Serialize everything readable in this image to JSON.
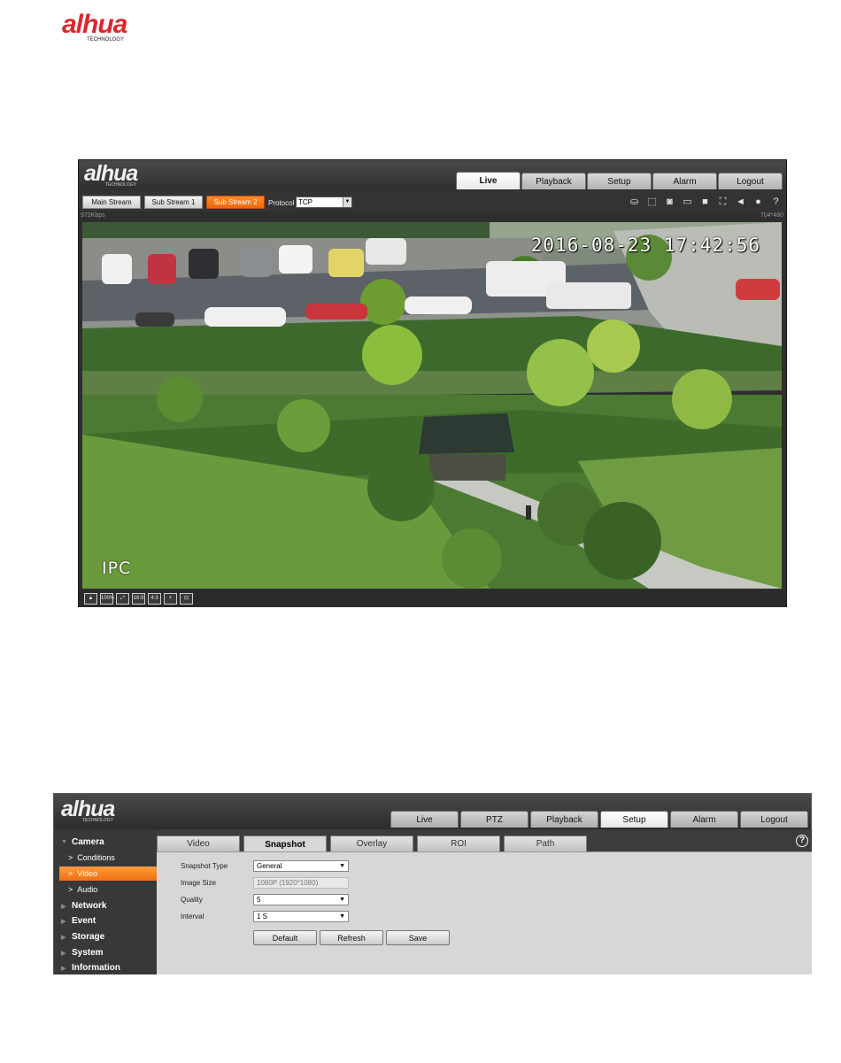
{
  "page": {
    "logo_text": "alhua",
    "logo_sub": "TECHNOLOGY"
  },
  "live": {
    "logo_text": "alhua",
    "logo_sub": "TECHNOLOGY",
    "tabs": [
      {
        "label": "Live",
        "active": true
      },
      {
        "label": "Playback",
        "active": false
      },
      {
        "label": "Setup",
        "active": false
      },
      {
        "label": "Alarm",
        "active": false
      },
      {
        "label": "Logout",
        "active": false
      }
    ],
    "streams": {
      "main": "Main Stream",
      "sub1": "Sub Stream 1",
      "sub2": "Sub Stream 2",
      "active": "Sub Stream 2"
    },
    "protocol_label": "Protocol",
    "protocol_value": "TCP",
    "bitrate": "972Kbps",
    "resolution": "704*480",
    "osd_time": "2016-08-23 17:42:56",
    "osd_name": "IPC",
    "toolbar_icons": [
      "user-icon",
      "region-zoom-icon",
      "snapshot-icon",
      "triple-snapshot-icon",
      "record-icon",
      "fullscreen-icon",
      "volume-icon",
      "microphone-icon",
      "help-icon"
    ],
    "bottom_icons": [
      {
        "name": "image-adjust-icon",
        "glyph": "▲"
      },
      {
        "name": "original-size-icon",
        "glyph": "100%"
      },
      {
        "name": "fit-window-icon",
        "glyph": "⤢"
      },
      {
        "name": "ratio-16-9-icon",
        "glyph": "16:9"
      },
      {
        "name": "ratio-4-3-icon",
        "glyph": "4:3"
      },
      {
        "name": "fluency-icon",
        "glyph": "+"
      },
      {
        "name": "rule-icon",
        "glyph": "⊡"
      }
    ]
  },
  "setup": {
    "logo_text": "alhua",
    "logo_sub": "TECHNOLOGY",
    "tabs": [
      {
        "label": "Live",
        "active": false
      },
      {
        "label": "PTZ",
        "active": false
      },
      {
        "label": "Playback",
        "active": false
      },
      {
        "label": "Setup",
        "active": true
      },
      {
        "label": "Alarm",
        "active": false
      },
      {
        "label": "Logout",
        "active": false
      }
    ],
    "sidebar": {
      "camera": "Camera",
      "conditions": "Conditions",
      "video": "Video",
      "audio": "Audio",
      "network": "Network",
      "event": "Event",
      "storage": "Storage",
      "system": "System",
      "information": "Information"
    },
    "subtabs": [
      "Video",
      "Snapshot",
      "Overlay",
      "ROI",
      "Path"
    ],
    "active_subtab": "Snapshot",
    "form": {
      "snapshot_type_label": "Snapshot Type",
      "snapshot_type_value": "General",
      "image_size_label": "Image Size",
      "image_size_value": "1080P (1920*1080)",
      "quality_label": "Quality",
      "quality_value": "5",
      "interval_label": "Interval",
      "interval_value": "1 S"
    },
    "buttons": {
      "default": "Default",
      "refresh": "Refresh",
      "save": "Save"
    }
  }
}
